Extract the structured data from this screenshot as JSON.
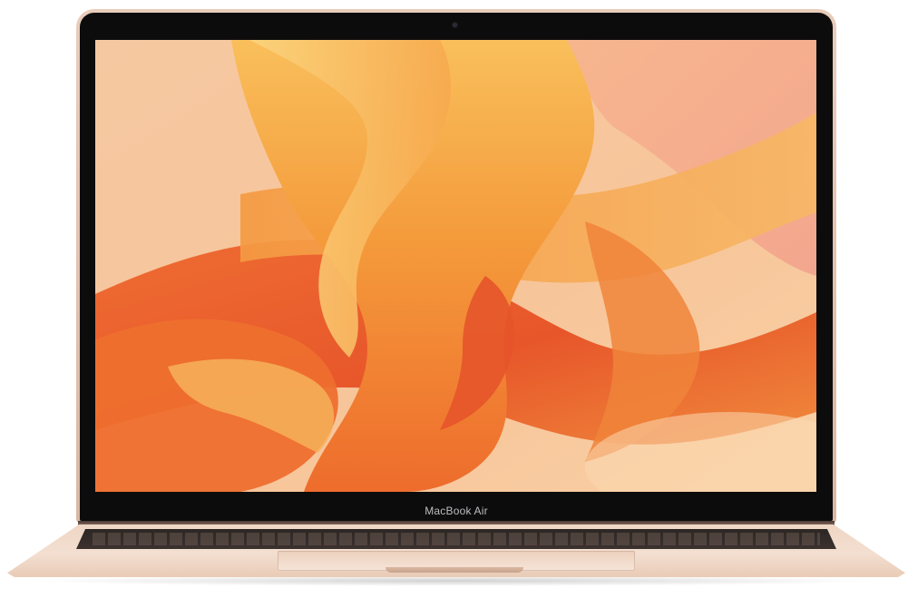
{
  "product": {
    "brand_label": "MacBook Air"
  },
  "colors": {
    "lid": "#e6c9b5",
    "bezel": "#0d0c0d",
    "screen_base": "#f7caa0",
    "wave_deep": "#ea5a2a",
    "wave_mid": "#f28a3a",
    "wave_light": "#f8b45c",
    "wave_highlight": "#fbd27a"
  },
  "icons": {
    "camera": "camera-icon"
  }
}
